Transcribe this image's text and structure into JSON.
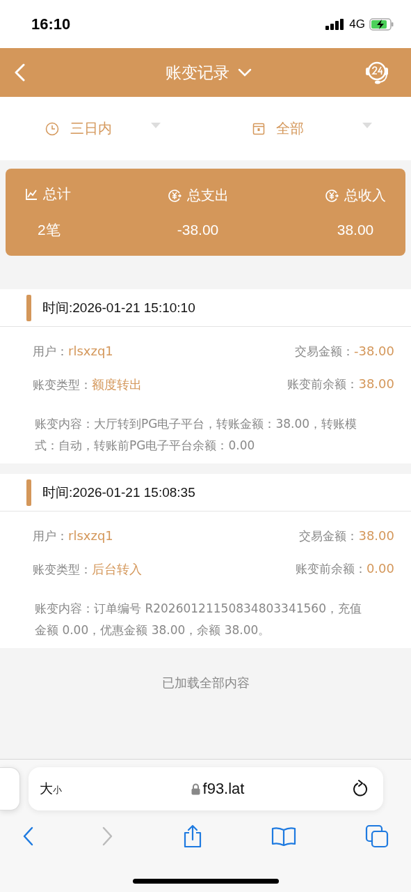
{
  "status_bar": {
    "time": "16:10",
    "network": "4G"
  },
  "header": {
    "title": "账变记录"
  },
  "filters": [
    {
      "kind": "clock",
      "label": "三日内"
    },
    {
      "kind": "calendar",
      "label": "全部"
    }
  ],
  "summary": [
    {
      "kind": "chart",
      "label": "总计",
      "value": "2笔"
    },
    {
      "kind": "yuan",
      "label": "总支出",
      "value": "-38.00"
    },
    {
      "kind": "yuan",
      "label": "总收入",
      "value": "38.00"
    }
  ],
  "records": [
    {
      "time": "时间:2026-01-21 15:10:10",
      "user_label": "用户：",
      "user": "rlsxzq1",
      "amount_label": "交易金额：",
      "amount": "-38.00",
      "type_label": "账变类型：",
      "type": "额度转出",
      "balance_label": "账变前余额：",
      "balance": "38.00",
      "content": "账变内容：大厅转到PG电子平台，转账金额：38.00，转账模式：自动，转账前PG电子平台余额：0.00"
    },
    {
      "time": "时间:2026-01-21 15:08:35",
      "user_label": "用户：",
      "user": "rlsxzq1",
      "amount_label": "交易金额：",
      "amount": "38.00",
      "type_label": "账变类型：",
      "type": "后台转入",
      "balance_label": "账变前余额：",
      "balance": "0.00",
      "content": "账变内容：订单编号 R20260121150834803341560，充值金额 0.00，优惠金额 38.00，余额 38.00。"
    }
  ],
  "footer_note": "已加载全部内容",
  "browser": {
    "text_size_large": "大",
    "text_size_small": "小",
    "url": "f93.lat"
  }
}
